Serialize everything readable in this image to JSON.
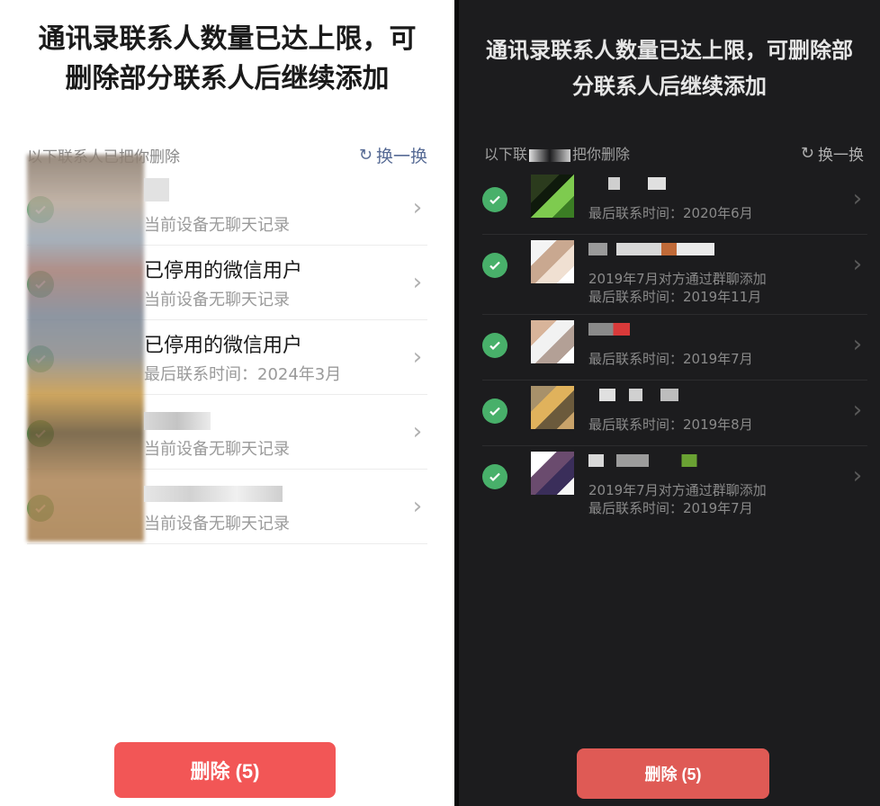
{
  "left": {
    "title": "通讯录联系人数量已达上限，可删除部分联系人后继续添加",
    "subtitle": "以下联系人已把你删除",
    "refresh_label": "换一换",
    "contacts": [
      {
        "name": "",
        "meta": "当前设备无聊天记录"
      },
      {
        "name": "已停用的微信用户",
        "meta": "当前设备无聊天记录"
      },
      {
        "name": "已停用的微信用户",
        "meta": "最后联系时间：2024年3月"
      },
      {
        "name": "",
        "meta": "当前设备无聊天记录"
      },
      {
        "name": "",
        "meta": "当前设备无聊天记录"
      }
    ],
    "delete_label": "删除 (5)"
  },
  "right": {
    "title": "通讯录联系人数量已达上限，可删除部分联系人后继续添加",
    "subtitle_start": "以下联",
    "subtitle_end": "把你删除",
    "refresh_label": "换一换",
    "contacts": [
      {
        "meta": "最后联系时间：2020年6月",
        "meta2": ""
      },
      {
        "meta": "2019年7月对方通过群聊添加",
        "meta2": "最后联系时间：2019年11月"
      },
      {
        "meta": "最后联系时间：2019年7月",
        "meta2": ""
      },
      {
        "meta": "最后联系时间：2019年8月",
        "meta2": ""
      },
      {
        "meta": "2019年7月对方通过群聊添加",
        "meta2": "最后联系时间：2019年7月"
      }
    ],
    "delete_label": "删除 (5)"
  },
  "colors": {
    "accent_green": "#2ea356",
    "danger_red": "#f25656",
    "link_blue": "#576b95"
  }
}
